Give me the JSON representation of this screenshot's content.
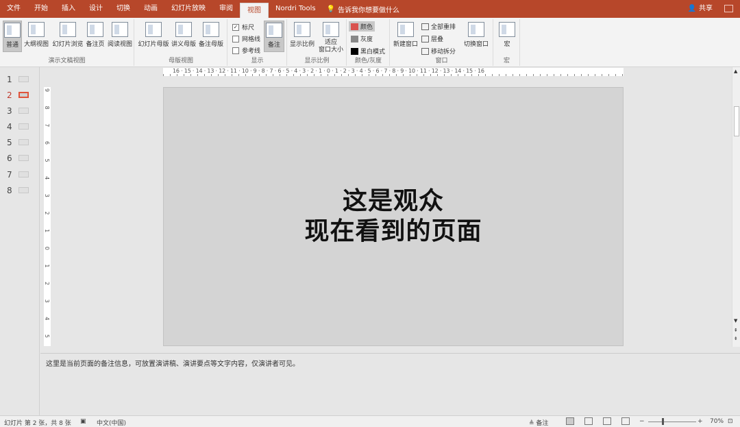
{
  "tabs": [
    "文件",
    "开始",
    "插入",
    "设计",
    "切换",
    "动画",
    "幻灯片放映",
    "审阅",
    "视图",
    "Nordri Tools"
  ],
  "tell_me": "告诉我你想要做什么",
  "share": "共享",
  "ribbon": {
    "presentation_views": {
      "label": "演示文稿视图",
      "buttons": [
        "普通",
        "大纲视图",
        "幻灯片浏览",
        "备注页",
        "阅读视图"
      ]
    },
    "master_views": {
      "label": "母版视图",
      "buttons": [
        "幻灯片母版",
        "讲义母版",
        "备注母版"
      ]
    },
    "show": {
      "label": "显示",
      "items": [
        "标尺",
        "网格线",
        "参考线"
      ],
      "checked": [
        true,
        false,
        false
      ],
      "notes": "备注"
    },
    "zoom": {
      "label": "显示比例",
      "buttons": [
        "显示比例",
        "适应\n窗口大小"
      ]
    },
    "color": {
      "label": "颜色/灰度",
      "items": [
        "颜色",
        "灰度",
        "黑白模式"
      ],
      "colors": [
        "#d9534f",
        "#888888",
        "#000000"
      ]
    },
    "window": {
      "label": "窗口",
      "new_window": "新建窗口",
      "items": [
        "全部重排",
        "层叠",
        "移动拆分"
      ],
      "switch": "切换窗口"
    },
    "macros": {
      "label": "宏",
      "button": "宏"
    }
  },
  "thumbs": [
    "1",
    "2",
    "3",
    "4",
    "5",
    "6",
    "7",
    "8"
  ],
  "slide": {
    "line1": "这是观众",
    "line2": "现在看到的页面"
  },
  "notes": "这里是当前页面的备注信息，可放置演讲稿、演讲要点等文字内容，仅演讲者可见。",
  "ruler_h": "16 · 15 · 14 · 13 · 12 · 11 · 10 · 9 · 8 · 7 · 6 · 5 · 4 · 3 · 2 · 1 · 0 · 1 · 2 · 3 · 4 · 5 · 6 · 7 · 8 · 9 · 10 · 11 · 12 · 13 · 14 · 15 · 16",
  "ruler_v": "9 8 7 6 5 4 3 2 1 0 1 2 3 4 5 6 7 8 9",
  "status": {
    "slide_info": "幻灯片 第 2 张，共 8 张",
    "language": "中文(中国)",
    "notes": "备注",
    "zoom": "70%",
    "minus": "−",
    "plus": "+"
  }
}
